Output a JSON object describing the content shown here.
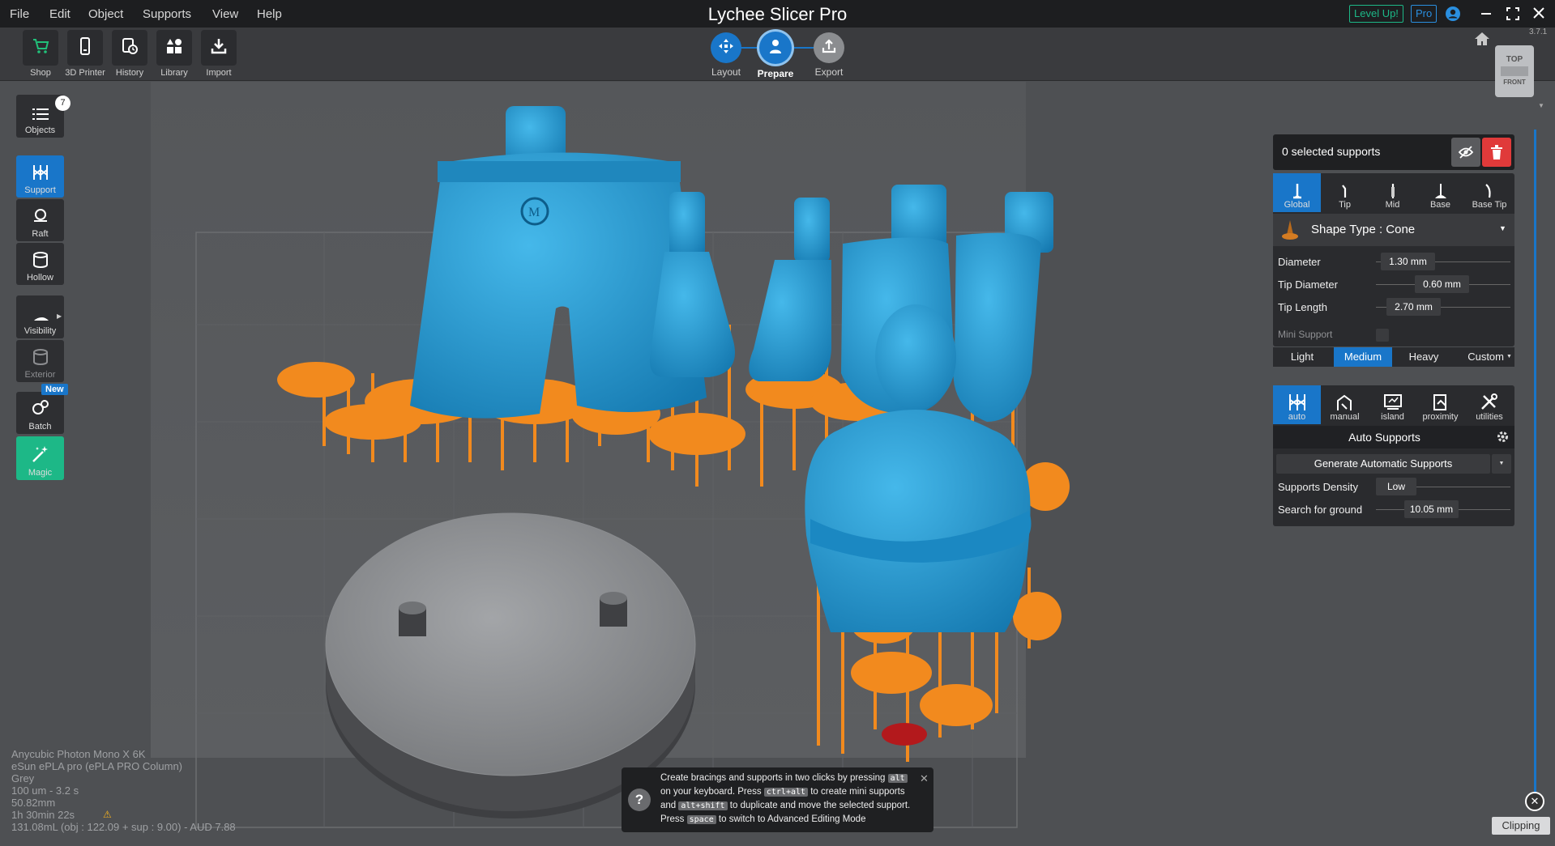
{
  "app": {
    "title": "Lychee Slicer Pro",
    "version": "3.7.1"
  },
  "menu": [
    "File",
    "Edit",
    "Object",
    "Supports",
    "View",
    "Help"
  ],
  "titlebar": {
    "levelup_label": "Level Up!",
    "pro_label": "Pro"
  },
  "toolbar": {
    "items": [
      {
        "label": "Shop",
        "icon": "cart-icon"
      },
      {
        "label": "3D Printer",
        "icon": "printer-icon"
      },
      {
        "label": "History",
        "icon": "history-icon"
      },
      {
        "label": "Library",
        "icon": "library-icon"
      },
      {
        "label": "Import",
        "icon": "import-icon"
      }
    ]
  },
  "workflow": {
    "steps": [
      {
        "label": "Layout",
        "icon": "move-icon"
      },
      {
        "label": "Prepare",
        "icon": "support-person-icon",
        "active": true
      },
      {
        "label": "Export",
        "icon": "export-icon"
      }
    ]
  },
  "sidebar": {
    "objects": {
      "label": "Objects",
      "count": "7"
    },
    "items": [
      {
        "label": "Support",
        "icon": "support-icon",
        "active": true
      },
      {
        "label": "Raft",
        "icon": "raft-icon"
      },
      {
        "label": "Hollow",
        "icon": "hollow-icon"
      },
      {
        "label": "Visibility",
        "icon": "visibility-icon"
      },
      {
        "label": "Exterior",
        "icon": "exterior-icon",
        "disabled": true
      },
      {
        "label": "Batch",
        "icon": "batch-icon",
        "badge": "New"
      },
      {
        "label": "Magic",
        "icon": "magic-icon",
        "accent": "#1db887"
      }
    ]
  },
  "viewcube": {
    "top": "TOP",
    "front": "FRONT"
  },
  "support_panel": {
    "selected_text": "0 selected supports",
    "tabs": [
      "Global",
      "Tip",
      "Mid",
      "Base",
      "Base Tip"
    ],
    "shape_type": "Shape Type : Cone",
    "diameter": {
      "label": "Diameter",
      "value": "1.30 mm",
      "fraction": 0.22
    },
    "tip_diameter": {
      "label": "Tip Diameter",
      "value": "0.60 mm",
      "fraction": 0.47
    },
    "tip_length": {
      "label": "Tip Length",
      "value": "2.70 mm",
      "fraction": 0.27
    },
    "mini_support_label": "Mini Support",
    "densities": [
      "Light",
      "Medium",
      "Heavy",
      "Custom"
    ],
    "active_density": "Medium"
  },
  "auto_panel": {
    "tabs": [
      "auto",
      "manual",
      "island",
      "proximity",
      "utilities"
    ],
    "title": "Auto Supports",
    "generate_label": "Generate Automatic Supports",
    "density": {
      "label": "Supports Density",
      "value": "Low",
      "fraction": 0.1
    },
    "search": {
      "label": "Search for ground",
      "value": "10.05 mm",
      "fraction": 0.38
    }
  },
  "info": [
    "Anycubic Photon Mono X 6K",
    "eSun ePLA pro (ePLA PRO Column)",
    "Grey",
    "100 um - 3.2 s",
    "50.82mm",
    "1h 30min 22s",
    "131.08mL (obj : 122.09 + sup : 9.00) - AUD 7.88"
  ],
  "tip": {
    "l1a": "Create bracings and supports in two clicks by pressing",
    "k1": "alt",
    "l2a": "on your keyboard. Press",
    "k2": "ctrl+alt",
    "l2b": "to create mini supports",
    "l3a": "and",
    "k3": "alt+shift",
    "l3b": "to duplicate and move the selected support.",
    "l4a": "Press",
    "k4": "space",
    "l4b": "to switch to Advanced Editing Mode"
  },
  "clipping_label": "Clipping",
  "colors": {
    "accent": "#1976c9",
    "support": "#f28a1e",
    "model": "#2aa3d8",
    "base": "#8e8f92",
    "batch_new": "#1976c9",
    "magic": "#1db887",
    "delete": "#e03a3a"
  }
}
